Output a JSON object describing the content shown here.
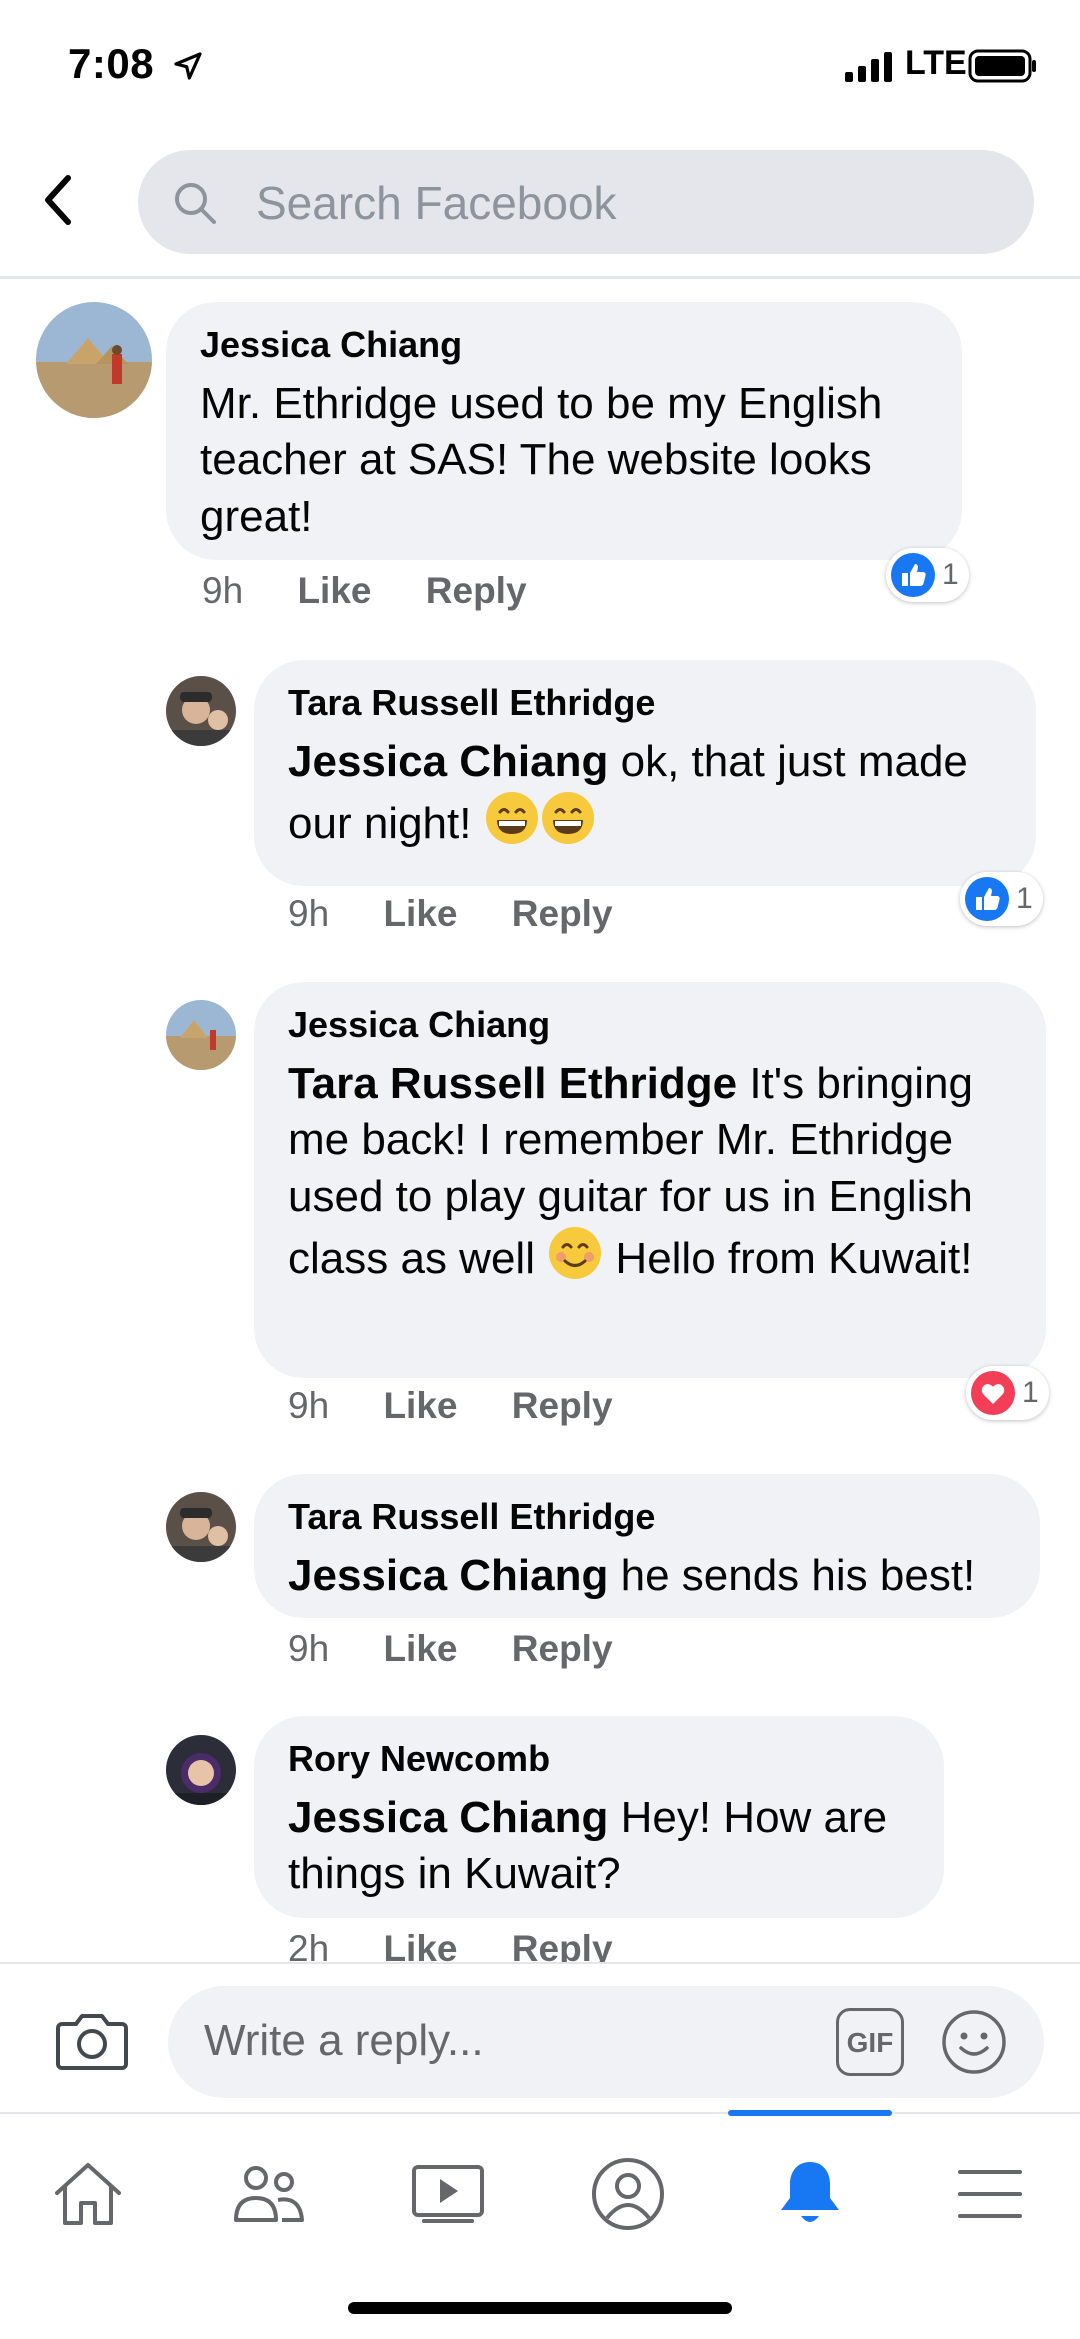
{
  "status_bar": {
    "time": "7:08",
    "carrier": "LTE"
  },
  "search": {
    "placeholder": "Search Facebook"
  },
  "comments": [
    {
      "author": "Jessica Chiang",
      "mention": "",
      "text": "Mr. Ethridge used to be my English teacher at SAS! The website looks great!",
      "time": "9h",
      "like": "Like",
      "reply": "Reply",
      "reaction": {
        "type": "like",
        "count": "1"
      }
    },
    {
      "author": "Tara Russell Ethridge",
      "mention": "Jessica Chiang",
      "text": " ok, that just made our night! ",
      "emoji": "grinning-face-emoji x2",
      "time": "9h",
      "like": "Like",
      "reply": "Reply",
      "reaction": {
        "type": "like",
        "count": "1"
      }
    },
    {
      "author": "Jessica Chiang",
      "mention": "Tara Russell Ethridge",
      "text_a": " It's bringing me back! I remember Mr. Ethridge used to play guitar for us in English class as well ",
      "text_b": " Hello from Kuwait!",
      "emoji": "smiling-face-emoji",
      "time": "9h",
      "like": "Like",
      "reply": "Reply",
      "reaction": {
        "type": "love",
        "count": "1"
      }
    },
    {
      "author": "Tara Russell Ethridge",
      "mention": "Jessica Chiang",
      "text": " he sends his best!",
      "time": "9h",
      "like": "Like",
      "reply": "Reply"
    },
    {
      "author": "Rory Newcomb",
      "mention": "Jessica Chiang",
      "text": " Hey! How are things in Kuwait?",
      "time": "2h",
      "like": "Like",
      "reply": "Reply"
    }
  ],
  "reply_bar": {
    "placeholder": "Write a reply...",
    "gif_label": "GIF"
  },
  "bottom_nav": {
    "items": [
      "home-icon",
      "friends-icon",
      "watch-icon",
      "profile-icon",
      "notifications-icon",
      "menu-icon"
    ],
    "active": "notifications-icon"
  },
  "colors": {
    "accent": "#1877f2",
    "bubble": "#f0f2f5",
    "muted": "#65676b",
    "love": "#f33e58"
  }
}
